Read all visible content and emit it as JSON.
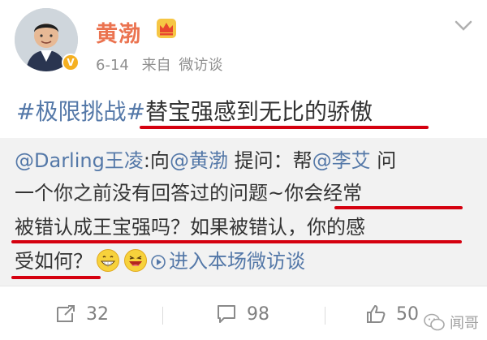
{
  "post": {
    "user_name": "黄渤",
    "date": "6-14",
    "source_prefix": "来自",
    "source": "微访谈",
    "title_tag": "#极限挑战#",
    "title_text": "替宝强感到无比的骄傲"
  },
  "repost": {
    "line1_mention": "@Darling王凌",
    "line1_text_a": ":向",
    "line1_mention2": "@黄渤",
    "line1_text_b": " 提问：帮",
    "line1_mention3": "@李艾",
    "line1_text_c": " 问",
    "line2": "一个你之前没有回答过的问题~你会经常",
    "line3": "被错认成王宝强吗？如果被错认，你的感",
    "line4_text": "受如何？",
    "line4_link": "进入本场微访谈"
  },
  "actions": {
    "repost_count": "32",
    "comment_count": "98",
    "like_count": "50"
  },
  "watermark": "闻哥",
  "icons": {
    "avatar": "avatar",
    "verified": "verified-badge-icon",
    "crown": "crown-icon",
    "more": "chevron-down-icon",
    "repost": "repost-icon",
    "comment": "comment-icon",
    "like": "thumbs-up-icon",
    "emoji1": "grin-emoji-icon",
    "emoji2": "laugh-emoji-icon",
    "play": "play-icon"
  },
  "colors": {
    "name": "#eb7350",
    "link": "#5478a8",
    "underline": "#d5000f",
    "repost_bg": "#f2f2f2"
  }
}
